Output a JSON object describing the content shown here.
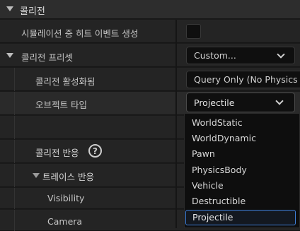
{
  "section": {
    "title": "콜리전"
  },
  "rows": {
    "sim_hit_label": "시뮬레이션 중 히트 이벤트 생성",
    "preset_label": "콜리전 프리셋",
    "preset_value": "Custom...",
    "enabled_label": "콜리전 활성화됨",
    "enabled_value": "Query Only (No Physics Collision)",
    "object_type_label": "오브젝트 타입",
    "object_type_value": "Projectile",
    "response_label": "콜리전 반응",
    "help_glyph": "?",
    "trace_label": "트레이스 반응",
    "visibility_label": "Visibility",
    "camera_label": "Camera"
  },
  "dropdown": {
    "options": [
      "WorldStatic",
      "WorldDynamic",
      "Pawn",
      "PhysicsBody",
      "Vehicle",
      "Destructible",
      "Projectile"
    ],
    "selected": "Projectile"
  },
  "colors": {
    "selection_border": "#3e7fd8",
    "background": "#242424"
  }
}
